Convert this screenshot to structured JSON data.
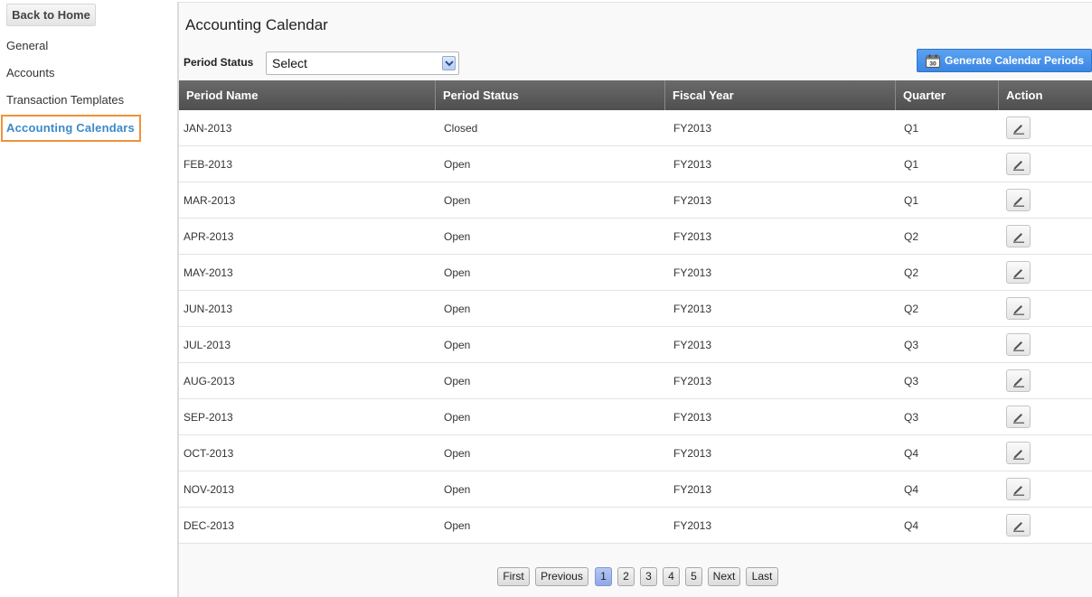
{
  "sidebar": {
    "back_label": "Back to Home",
    "items": [
      {
        "label": "General"
      },
      {
        "label": "Accounts"
      },
      {
        "label": "Transaction Templates"
      },
      {
        "label": "Accounting Calendars",
        "active": true
      }
    ]
  },
  "main": {
    "title": "Accounting Calendar",
    "filter_label": "Period Status",
    "filter_value": "Select",
    "generate_label": "Generate Calendar Periods"
  },
  "table": {
    "columns": [
      "Period Name",
      "Period Status",
      "Fiscal Year",
      "Quarter",
      "Action"
    ],
    "rows": [
      {
        "period": "JAN-2013",
        "status": "Closed",
        "year": "FY2013",
        "quarter": "Q1"
      },
      {
        "period": "FEB-2013",
        "status": "Open",
        "year": "FY2013",
        "quarter": "Q1"
      },
      {
        "period": "MAR-2013",
        "status": "Open",
        "year": "FY2013",
        "quarter": "Q1"
      },
      {
        "period": "APR-2013",
        "status": "Open",
        "year": "FY2013",
        "quarter": "Q2"
      },
      {
        "period": "MAY-2013",
        "status": "Open",
        "year": "FY2013",
        "quarter": "Q2"
      },
      {
        "period": "JUN-2013",
        "status": "Open",
        "year": "FY2013",
        "quarter": "Q2"
      },
      {
        "period": "JUL-2013",
        "status": "Open",
        "year": "FY2013",
        "quarter": "Q3"
      },
      {
        "period": "AUG-2013",
        "status": "Open",
        "year": "FY2013",
        "quarter": "Q3"
      },
      {
        "period": "SEP-2013",
        "status": "Open",
        "year": "FY2013",
        "quarter": "Q3"
      },
      {
        "period": "OCT-2013",
        "status": "Open",
        "year": "FY2013",
        "quarter": "Q4"
      },
      {
        "period": "NOV-2013",
        "status": "Open",
        "year": "FY2013",
        "quarter": "Q4"
      },
      {
        "period": "DEC-2013",
        "status": "Open",
        "year": "FY2013",
        "quarter": "Q4"
      }
    ]
  },
  "pagination": {
    "first": "First",
    "previous": "Previous",
    "pages": [
      "1",
      "2",
      "3",
      "4",
      "5"
    ],
    "current": "1",
    "next": "Next",
    "last": "Last"
  },
  "colors": {
    "accent_orange": "#f0923a",
    "active_link": "#3a8ac9",
    "primary_button": "#3b86e2",
    "table_header": "#595959"
  }
}
